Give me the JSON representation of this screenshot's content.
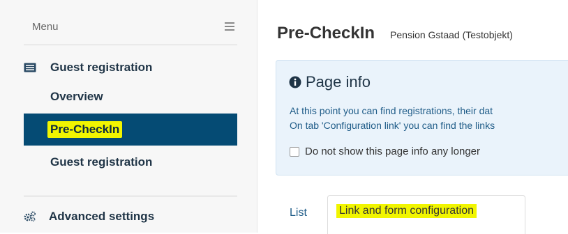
{
  "sidebar": {
    "menu_title": "Menu",
    "section": "Guest registration",
    "items": [
      {
        "label": "Overview"
      },
      {
        "label": "Pre-CheckIn"
      },
      {
        "label": "Guest registration"
      }
    ],
    "advanced": "Advanced settings"
  },
  "header": {
    "title": "Pre-CheckIn",
    "subtitle": "Pension Gstaad (Testobjekt)"
  },
  "info": {
    "title": "Page info",
    "line1": "At this point you can find registrations, their dat",
    "line2": "On tab 'Configuration link' you can find the links",
    "checkbox_label": "Do not show this page info any longer"
  },
  "tabs": {
    "list": "List",
    "config": "Link and form configuration"
  },
  "colors": {
    "active_bg": "#054b74",
    "highlight": "#f1f500",
    "info_bg": "#eaf3fb"
  }
}
